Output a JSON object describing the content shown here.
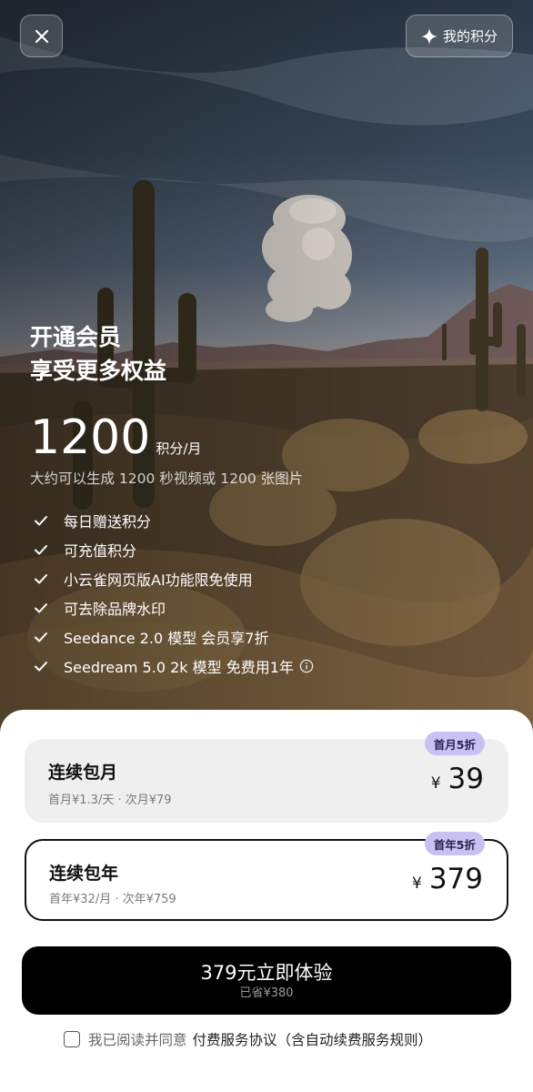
{
  "topbar": {
    "close_icon": "close-icon",
    "points_button_label": "我的积分",
    "points_icon": "sparkle-icon"
  },
  "hero": {
    "headline_line1": "开通会员",
    "headline_line2": "享受更多权益",
    "credits_number": "1200",
    "credits_unit": "积分/月",
    "credits_desc": "大约可以生成 1200 秒视频或 1200 张图片",
    "benefits": [
      "每日赠送积分",
      "可充值积分",
      "小云雀网页版AI功能限免使用",
      "可去除品牌水印",
      "Seedance 2.0 模型 会员享7折",
      "Seedream 5.0 2k 模型 免费用1年"
    ]
  },
  "plans": [
    {
      "name": "连续包月",
      "sub": "首月¥1.3/天 · 次月¥79",
      "currency": "¥",
      "price": "39",
      "badge": "首月5折"
    },
    {
      "name": "连续包年",
      "sub": "首年¥32/月 · 次年¥759",
      "currency": "¥",
      "price": "379",
      "badge": "首年5折"
    }
  ],
  "cta": {
    "label": "379元立即体验",
    "sub": "已省¥380"
  },
  "agreement": {
    "prefix": "我已阅读并同意",
    "link": "付费服务协议（含自动续费服务规则）"
  },
  "colors": {
    "badge_bg": "#c8c1f2",
    "cta_bg": "#000000",
    "selected_border": "#111111"
  }
}
